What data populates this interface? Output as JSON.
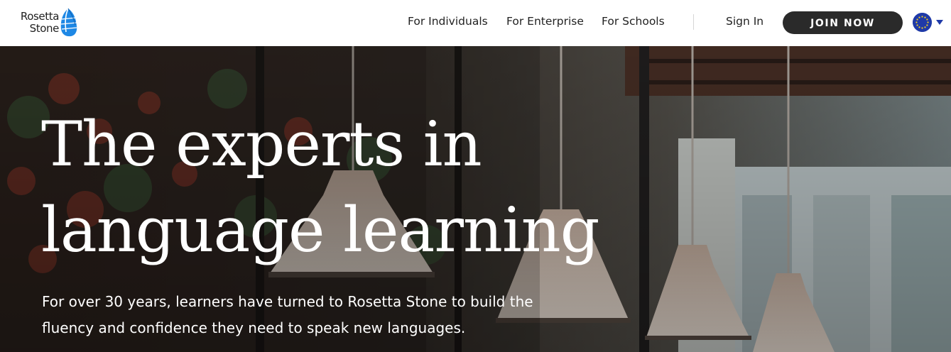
{
  "brand": {
    "name_line1": "Rosetta",
    "name_line2": "Stone",
    "logo_color": "#1e88e5"
  },
  "nav": {
    "links": [
      "For Individuals",
      "For Enterprise",
      "For Schools"
    ],
    "sign_in": "Sign In",
    "join_label": "JOIN NOW",
    "locale_icon": "eu-flag-icon"
  },
  "hero": {
    "title_line1": "The experts in",
    "title_line2": "language learning",
    "subtitle_line1": "For over 30 years, learners have turned to Rosetta Stone to build the",
    "subtitle_line2": "fluency and confidence they need to speak new languages."
  },
  "colors": {
    "button_bg": "#2a2a2a",
    "flag_blue": "#1f3aa8",
    "flag_stars": "#f5d020"
  }
}
